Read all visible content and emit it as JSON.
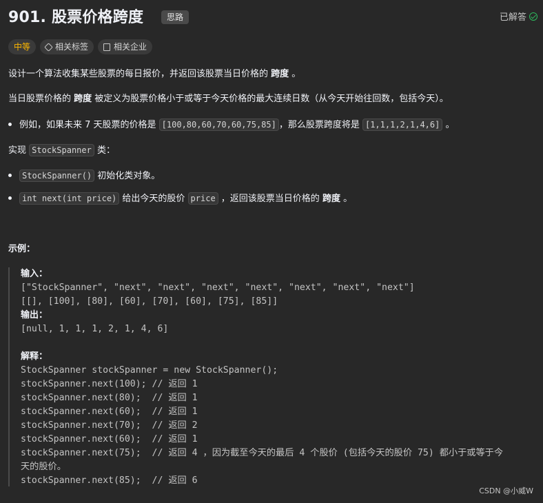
{
  "header": {
    "title": "901. 股票价格跨度",
    "hint_badge": "思路",
    "solved_label": "已解答"
  },
  "tags": {
    "difficulty": "中等",
    "related_tags": "相关标签",
    "related_companies": "相关企业"
  },
  "description": {
    "p1_a": "设计一个算法收集某些股票的每日报价，并返回该股票当日价格的 ",
    "p1_bold": "跨度",
    "p1_b": " 。",
    "p2_a": "当日股票价格的 ",
    "p2_bold": "跨度",
    "p2_b": " 被定义为股票价格小于或等于今天价格的最大连续日数（从今天开始往回数，包括今天）。",
    "b1_a": "例如，如果未来 7 天股票的价格是 ",
    "b1_code": "[100,80,60,70,60,75,85]",
    "b1_b": "，那么股票跨度将是 ",
    "b1_code2": "[1,1,1,2,1,4,6]",
    "b1_c": " 。",
    "impl_a": "实现 ",
    "impl_code": "StockSpanner",
    "impl_b": " 类：",
    "b2_code": "StockSpanner()",
    "b2_text": " 初始化类对象。",
    "b3_code": "int next(int price)",
    "b3_a": " 给出今天的股价 ",
    "b3_code2": "price",
    "b3_b": " ，返回该股票当日价格的 ",
    "b3_bold": "跨度",
    "b3_c": " 。"
  },
  "example": {
    "heading": "示例：",
    "input_label": "输入：",
    "input_line1": "[\"StockSpanner\", \"next\", \"next\", \"next\", \"next\", \"next\", \"next\", \"next\"]",
    "input_line2": "[[], [100], [80], [60], [70], [60], [75], [85]]",
    "output_label": "输出：",
    "output_line": "[null, 1, 1, 1, 2, 1, 4, 6]",
    "explain_label": "解释：",
    "lines": [
      "StockSpanner stockSpanner = new StockSpanner();",
      "stockSpanner.next(100); // 返回 1",
      "stockSpanner.next(80);  // 返回 1",
      "stockSpanner.next(60);  // 返回 1",
      "stockSpanner.next(70);  // 返回 2",
      "stockSpanner.next(60);  // 返回 1",
      "stockSpanner.next(75);  // 返回 4 ，因为截至今天的最后 4 个股价 (包括今天的股价 75) 都小于或等于今",
      "天的股价。",
      "stockSpanner.next(85);  // 返回 6"
    ]
  },
  "watermark": "CSDN @小威W"
}
